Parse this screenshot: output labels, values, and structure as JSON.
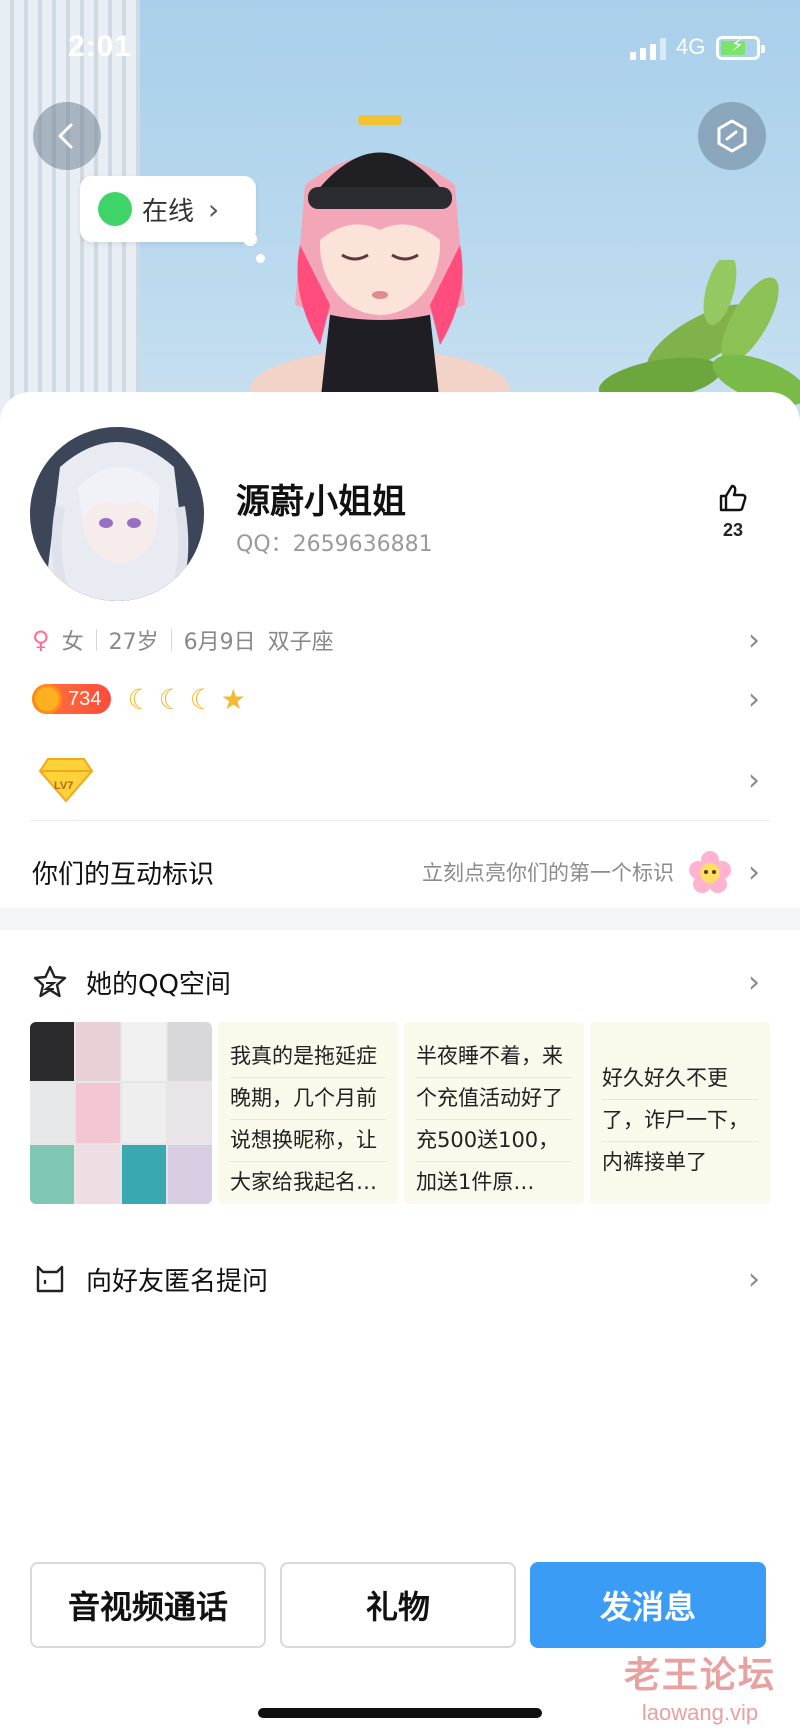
{
  "status_bar": {
    "time": "2:01",
    "network": "4G"
  },
  "header": {
    "online_status": "在线"
  },
  "profile": {
    "nickname": "源蔚小姐姐",
    "qq_label": "QQ：2659636881",
    "like_count": "23",
    "gender": "女",
    "age": "27岁",
    "birthday": "6月9日",
    "zodiac": "双子座",
    "level": "734",
    "vip_level": "LV7"
  },
  "interaction": {
    "title": "你们的互动标识",
    "hint": "立刻点亮你们的第一个标识"
  },
  "qzone": {
    "title": "她的QQ空间",
    "posts": [
      {
        "lines": [
          "我真的是拖延症",
          "晚期，几个月前",
          "说想换昵称，让",
          "大家给我起名…"
        ]
      },
      {
        "lines": [
          "半夜睡不着，来",
          "个充值活动好了",
          "充500送100，",
          "加送1件原…"
        ]
      },
      {
        "lines": [
          "好久好久不更",
          "了，诈尸一下，",
          "内裤接单了"
        ]
      }
    ]
  },
  "ask": {
    "title": "向好友匿名提问"
  },
  "actions": {
    "call": "音视频通话",
    "gift": "礼物",
    "message": "发消息"
  },
  "watermark": {
    "name": "老王论坛",
    "url": "laowang.vip"
  },
  "colors": {
    "primary": "#3b9cf5",
    "online": "#3fd46a",
    "female": "#ff6f9c"
  }
}
